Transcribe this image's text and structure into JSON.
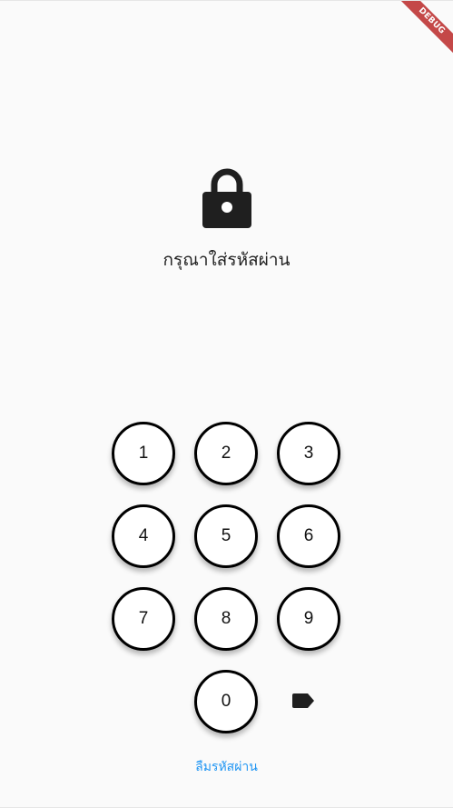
{
  "debug_banner": {
    "label": "DEBUG",
    "color": "#b71c1c"
  },
  "lock": {
    "icon": "lock-icon"
  },
  "prompt": {
    "text": "กรุณาใส่รหัสผ่าน"
  },
  "keypad": {
    "keys": [
      "1",
      "2",
      "3",
      "4",
      "5",
      "6",
      "7",
      "8",
      "9",
      "0"
    ],
    "backspace_icon": "backspace-icon"
  },
  "forgot_password": {
    "label": "ลืมรหัสผ่าน",
    "color": "#2196f3"
  }
}
